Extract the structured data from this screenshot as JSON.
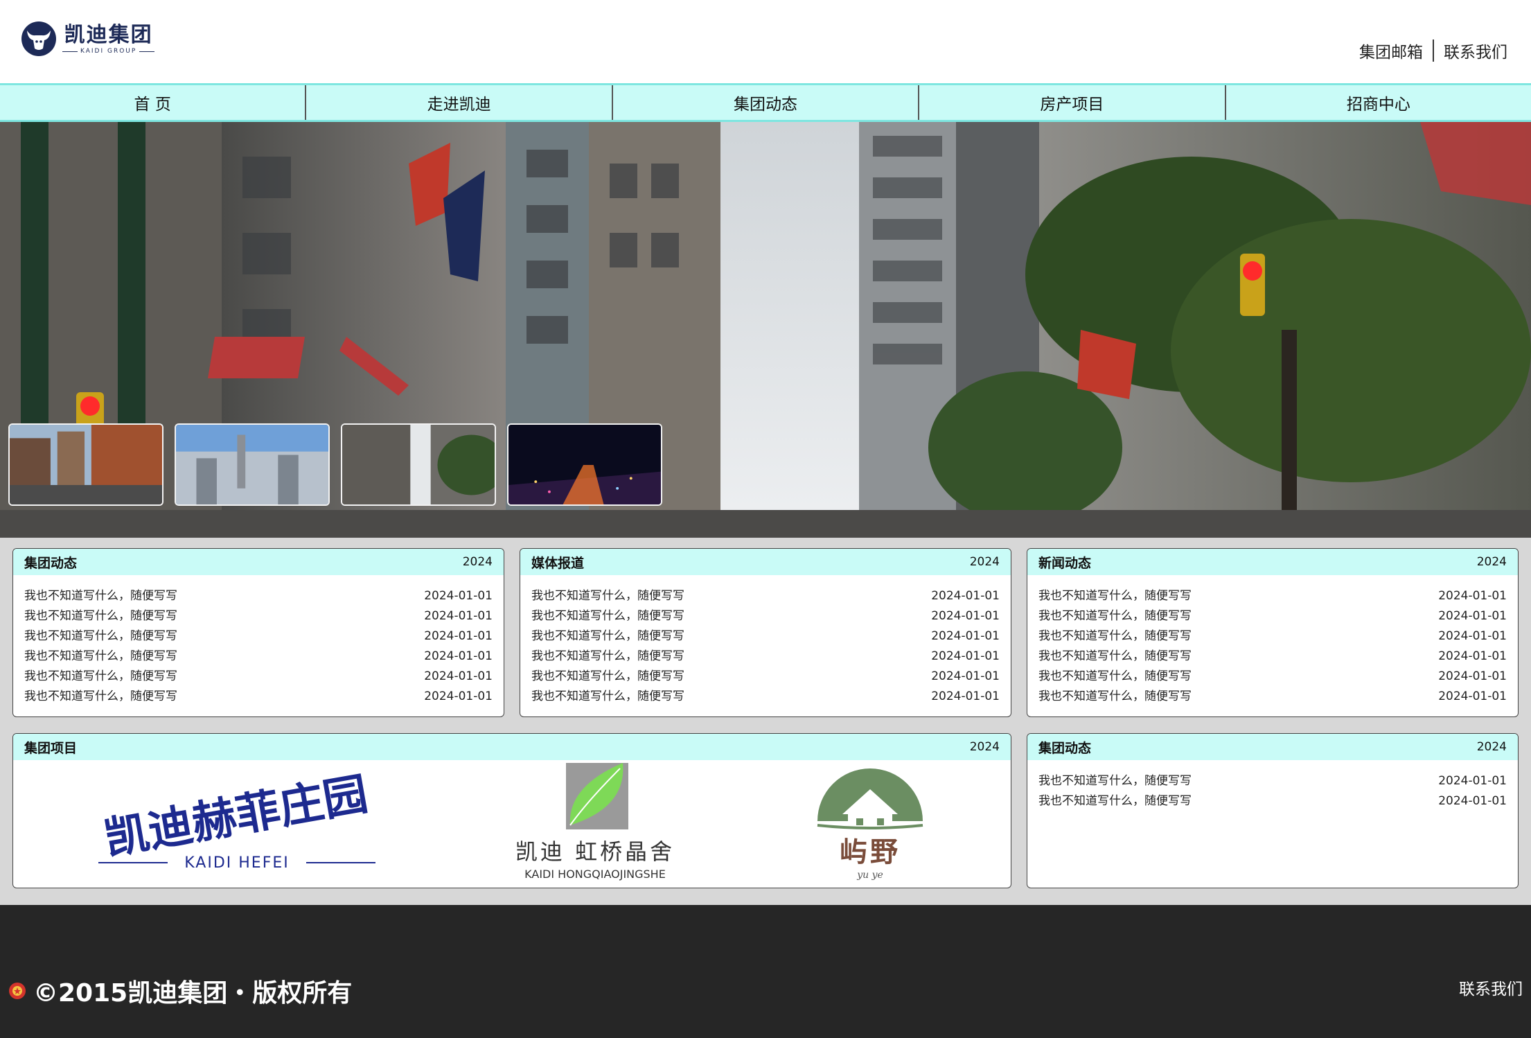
{
  "header": {
    "logo_cn": "凯迪集团",
    "logo_en": "KAIDI GROUP",
    "links": [
      "集团邮箱",
      "联系我们"
    ]
  },
  "nav": [
    "首 页",
    "走进凯迪",
    "集团动态",
    "房产项目",
    "招商中心"
  ],
  "hero": {
    "image": "city-street-photo",
    "thumbnails": [
      "city-buildings-thumb",
      "skyline-thumb",
      "street-thumb",
      "night-city-thumb"
    ]
  },
  "panels": {
    "group_news": {
      "title": "集团动态",
      "year": "2024",
      "items": [
        {
          "text": "我也不知道写什么，随便写写",
          "date": "2024-01-01"
        },
        {
          "text": "我也不知道写什么，随便写写",
          "date": "2024-01-01"
        },
        {
          "text": "我也不知道写什么，随便写写",
          "date": "2024-01-01"
        },
        {
          "text": "我也不知道写什么，随便写写",
          "date": "2024-01-01"
        },
        {
          "text": "我也不知道写什么，随便写写",
          "date": "2024-01-01"
        },
        {
          "text": "我也不知道写什么，随便写写",
          "date": "2024-01-01"
        }
      ]
    },
    "media": {
      "title": "媒体报道",
      "year": "2024",
      "items": [
        {
          "text": "我也不知道写什么，随便写写",
          "date": "2024-01-01"
        },
        {
          "text": "我也不知道写什么，随便写写",
          "date": "2024-01-01"
        },
        {
          "text": "我也不知道写什么，随便写写",
          "date": "2024-01-01"
        },
        {
          "text": "我也不知道写什么，随便写写",
          "date": "2024-01-01"
        },
        {
          "text": "我也不知道写什么，随便写写",
          "date": "2024-01-01"
        },
        {
          "text": "我也不知道写什么，随便写写",
          "date": "2024-01-01"
        }
      ]
    },
    "news": {
      "title": "新闻动态",
      "year": "2024",
      "items": [
        {
          "text": "我也不知道写什么，随便写写",
          "date": "2024-01-01"
        },
        {
          "text": "我也不知道写什么，随便写写",
          "date": "2024-01-01"
        },
        {
          "text": "我也不知道写什么，随便写写",
          "date": "2024-01-01"
        },
        {
          "text": "我也不知道写什么，随便写写",
          "date": "2024-01-01"
        },
        {
          "text": "我也不知道写什么，随便写写",
          "date": "2024-01-01"
        },
        {
          "text": "我也不知道写什么，随便写写",
          "date": "2024-01-01"
        }
      ]
    },
    "projects": {
      "title": "集团项目",
      "year": "2024",
      "logos": [
        {
          "cn": "凯迪赫菲庄园",
          "en": "KAIDI  HEFEI"
        },
        {
          "cn": "凯迪  虹桥晶舍",
          "en": "KAIDI HONGQIAOJINGSHE"
        },
        {
          "cn": "屿野",
          "en": "yu   ye"
        }
      ]
    },
    "group_news_2": {
      "title": "集团动态",
      "year": "2024",
      "items": [
        {
          "text": "我也不知道写什么，随便写写",
          "date": "2024-01-01"
        },
        {
          "text": "我也不知道写什么，随便写写",
          "date": "2024-01-01"
        }
      ]
    }
  },
  "footer": {
    "copyright": "©2015凯迪集团・版权所有",
    "contact": "联系我们"
  },
  "colors": {
    "nav_bg": "#c9fbf7",
    "brand_navy": "#1d2a57",
    "footer_bg": "#262626",
    "content_bg": "#d7d7d7"
  }
}
